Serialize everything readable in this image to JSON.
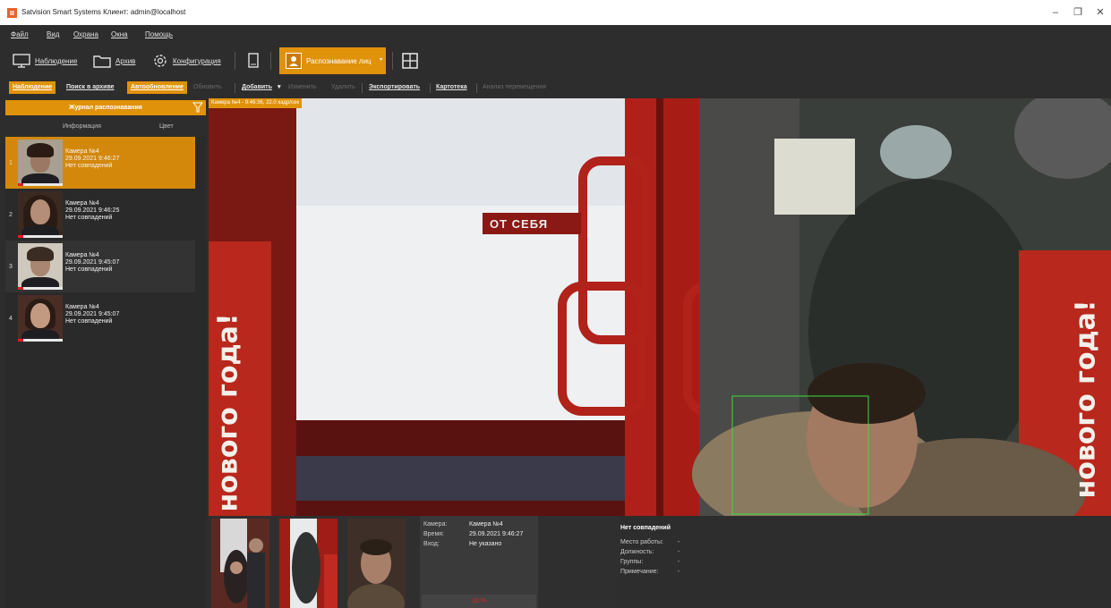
{
  "window": {
    "title": "Satvision Smart Systems Клиент: admin@localhost",
    "minimize": "–",
    "maximize": "❐",
    "close": "✕"
  },
  "menu": [
    "Файл",
    "Вид",
    "Охрана",
    "Окна",
    "Помощь"
  ],
  "toolbar": {
    "observation": "Наблюдение",
    "archive": "Архив",
    "configuration": "Конфигурация",
    "face_recognition": "Распознавание лиц"
  },
  "subbar": {
    "observation": "Наблюдение",
    "archive_search": "Поиск в архиве",
    "autorefresh": "Автообновление",
    "refresh": "Обновить",
    "add": "Добавить",
    "edit": "Изменить",
    "delete": "Удалить",
    "export": "Экспортировать",
    "card_index": "Картотека",
    "movement_analysis": "Анализ перемещения"
  },
  "journal": {
    "title": "Журнал распознавания",
    "col_info": "Информация",
    "col_color": "Цвет",
    "items": [
      {
        "num": "1",
        "camera": "Камера №4",
        "time": "29.09.2021 9:46:27",
        "status": "Нет совпадений"
      },
      {
        "num": "2",
        "camera": "Камера №4",
        "time": "29.09.2021 9:46:25",
        "status": "Нет совпадений"
      },
      {
        "num": "3",
        "camera": "Камера №4",
        "time": "29.09.2021 9:45:07",
        "status": "Нет совпадений"
      },
      {
        "num": "4",
        "camera": "Камера №4",
        "time": "29.09.2021 9:45:07",
        "status": "Нет совпадений"
      }
    ]
  },
  "video": {
    "label": "Камера №4 - 9:46:36, 22.0 кадр/сек",
    "sign_door": "ОТ СЕБЯ",
    "poster_left": "нового года!",
    "poster_right": "нового года!",
    "accent": "#e0920a",
    "face_box_color": "#3cdc3c"
  },
  "details": {
    "camera_k": "Камера:",
    "camera_v": "Камера №4",
    "time_k": "Время:",
    "time_v": "29.09.2021 9:46:27",
    "entry_k": "Вход:",
    "entry_v": "Не указано",
    "percent": "10 %"
  },
  "match": {
    "header": "Нет совпадений",
    "work_k": "Место работы:",
    "work_v": "-",
    "position_k": "Должность:",
    "position_v": "-",
    "groups_k": "Группы:",
    "groups_v": "-",
    "note_k": "Примечание:",
    "note_v": "-"
  }
}
